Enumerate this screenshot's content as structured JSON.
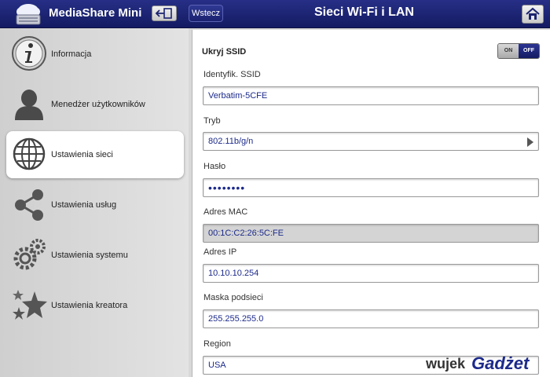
{
  "header": {
    "app_name": "MediaShare Mini",
    "back_label": "Wstecz",
    "page_title": "Sieci Wi-Fi i LAN",
    "icons": {
      "logo": "cloud-drive-logo",
      "exit": "exit-icon",
      "home": "home-icon"
    }
  },
  "sidebar": {
    "items": [
      {
        "label": "Informacja",
        "icon": "info-icon",
        "active": false
      },
      {
        "label": "Menedżer użytkowników",
        "icon": "user-icon",
        "active": false
      },
      {
        "label": "Ustawienia sieci",
        "icon": "globe-icon",
        "active": true
      },
      {
        "label": "Ustawienia usług",
        "icon": "share-icon",
        "active": false
      },
      {
        "label": "Ustawienia systemu",
        "icon": "gears-icon",
        "active": false
      },
      {
        "label": "Ustawienia kreatora",
        "icon": "stars-icon",
        "active": false
      }
    ]
  },
  "form": {
    "hide_ssid": {
      "label": "Ukryj SSID",
      "on_label": "ON",
      "off_label": "OFF",
      "state": "OFF"
    },
    "ssid": {
      "label": "Identyfik. SSID",
      "value": "Verbatim-5CFE"
    },
    "mode": {
      "label": "Tryb",
      "value": "802.11b/g/n"
    },
    "password": {
      "label": "Hasło",
      "value": "••••••••"
    },
    "mac": {
      "label": "Adres MAC",
      "value": "00:1C:C2:26:5C:FE"
    },
    "ip": {
      "label": "Adres IP",
      "value": "10.10.10.254"
    },
    "netmask": {
      "label": "Maska podsieci",
      "value": "255.255.255.0"
    },
    "region": {
      "label": "Region",
      "value": "USA"
    }
  },
  "watermark": {
    "part1": "wujek",
    "part2": "Gadżet"
  },
  "colors": {
    "header_bg": "#1c2470",
    "accent": "#1c2a8a",
    "readonly_bg": "#d4d4d4"
  }
}
